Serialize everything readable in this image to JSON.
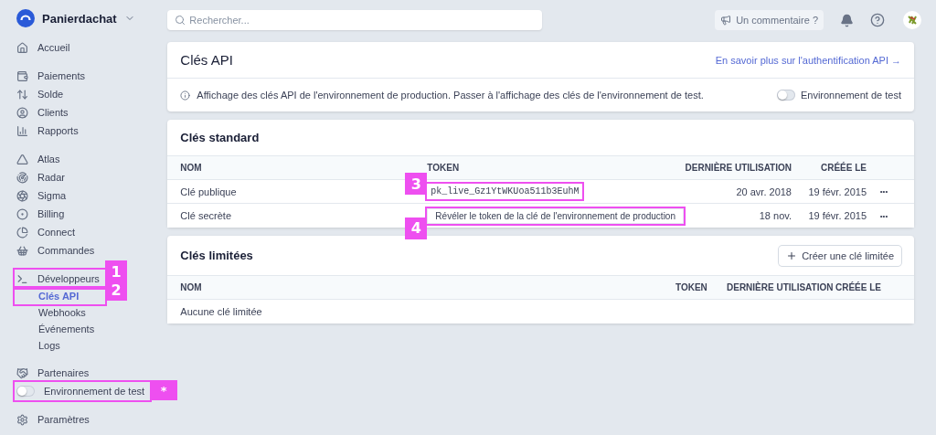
{
  "account": {
    "name": "Panierdachat"
  },
  "sidebar": {
    "groups": [
      {
        "items": [
          {
            "label": "Accueil",
            "kind": "link",
            "selected": false
          }
        ]
      },
      {
        "items": [
          {
            "label": "Paiements",
            "kind": "link",
            "selected": false
          },
          {
            "label": "Solde",
            "kind": "link",
            "selected": false
          },
          {
            "label": "Clients",
            "kind": "link",
            "selected": false
          },
          {
            "label": "Rapports",
            "kind": "link",
            "selected": false
          }
        ]
      },
      {
        "items": [
          {
            "label": "Atlas",
            "kind": "link",
            "selected": false
          },
          {
            "label": "Radar",
            "kind": "link",
            "selected": false
          },
          {
            "label": "Sigma",
            "kind": "link",
            "selected": false
          },
          {
            "label": "Billing",
            "kind": "link",
            "selected": false
          },
          {
            "label": "Connect",
            "kind": "link",
            "selected": false
          },
          {
            "label": "Commandes",
            "kind": "link",
            "selected": false
          }
        ]
      },
      {
        "items": [
          {
            "label": "Développeurs",
            "kind": "link",
            "selected": false,
            "callout": "1"
          },
          {
            "label": "Clés API",
            "kind": "sub",
            "selected": true,
            "callout": "2"
          },
          {
            "label": "Webhooks",
            "kind": "sub",
            "selected": false
          },
          {
            "label": "Événements",
            "kind": "sub",
            "selected": false
          },
          {
            "label": "Logs",
            "kind": "sub",
            "selected": false
          }
        ]
      },
      {
        "items": [
          {
            "label": "Partenaires",
            "kind": "link",
            "selected": false
          },
          {
            "label": "Environnement de test",
            "kind": "toggle",
            "on": false,
            "callout": "*"
          }
        ]
      },
      {
        "items": [
          {
            "label": "Paramètres",
            "kind": "link",
            "selected": false
          }
        ]
      }
    ]
  },
  "topbar": {
    "search_placeholder": "Rechercher...",
    "feedback": "Un commentaire ?"
  },
  "api_card": {
    "title": "Clés API",
    "link": "En savoir plus sur l'authentification API →",
    "notice": "Affichage des clés API de l'environnement de production. Passer à l'affichage des clés de l'environnement de test.",
    "toggle": {
      "label": "Environnement de test",
      "on": false
    }
  },
  "standard_keys": {
    "title": "Clés standard",
    "columns": [
      "NOM",
      "TOKEN",
      "DERNIÈRE UTILISATION",
      "CRÉÉE LE"
    ],
    "rows": [
      {
        "name": "Clé publique",
        "token": "pk_live_Gz1YtWKUoa511b3EuhM",
        "kind": "code",
        "last_used": "20 avr. 2018",
        "created": "19 févr. 2015",
        "callout": "3",
        "menu": "•••"
      },
      {
        "name": "Clé secrète",
        "token": "Révéler le token de la clé de l'environnement de production",
        "kind": "reveal",
        "last_used": "18 nov.",
        "created": "19 févr. 2015",
        "callout": "4",
        "menu": "•••"
      }
    ]
  },
  "restricted_keys": {
    "title": "Clés limitées",
    "button": "Créer une clé limitée",
    "columns": [
      "NOM",
      "TOKEN",
      "DERNIÈRE UTILISATION",
      "CRÉÉE LE"
    ],
    "empty": "Aucune clé limitée"
  }
}
